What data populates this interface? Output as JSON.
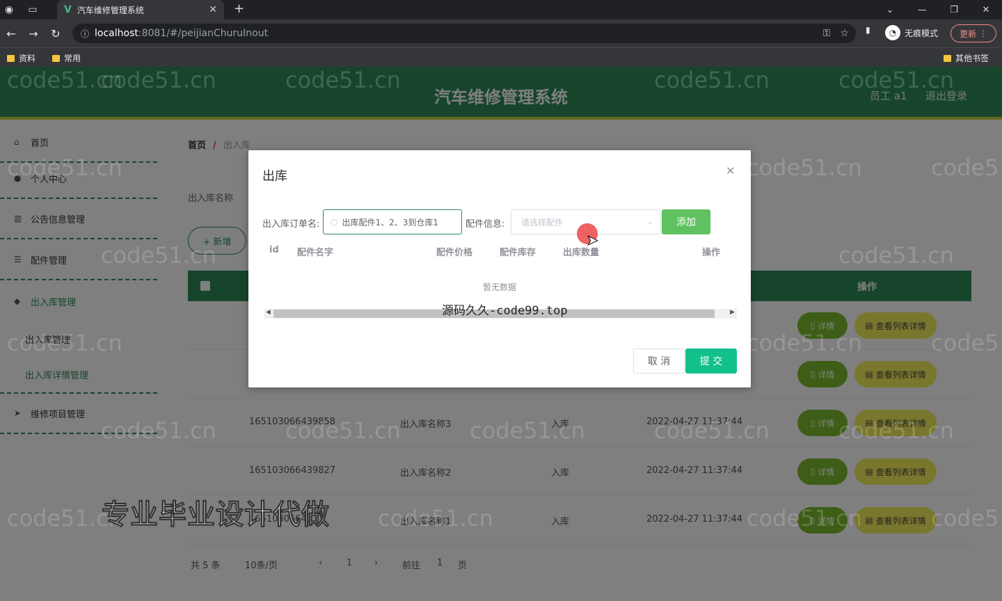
{
  "browser": {
    "tab_title": "汽车维修管理系统",
    "url_host": "localhost",
    "url_path": ":8081/#/peijianChuruInout",
    "incognito_label": "无痕模式",
    "update_label": "更新",
    "bookmarks": [
      "资料",
      "常用"
    ],
    "other_bookmarks": "其他书签"
  },
  "header": {
    "title": "汽车维修管理系统",
    "user": "员工 a1",
    "logout": "退出登录"
  },
  "sidebar": {
    "items": [
      {
        "label": "首页",
        "icon": "home-icon"
      },
      {
        "label": "个人中心",
        "icon": "user-icon"
      },
      {
        "label": "公告信息管理",
        "icon": "chart-icon"
      },
      {
        "label": "配件管理",
        "icon": "list-icon"
      },
      {
        "label": "出入库管理",
        "icon": "box-icon"
      }
    ],
    "sub_items": [
      "出入库管理",
      "出入库详情管理"
    ],
    "last_item": {
      "label": "维修项目管理",
      "icon": "send-icon"
    }
  },
  "breadcrumb": {
    "home": "首页",
    "sep": "/",
    "current": "出入库"
  },
  "filter": {
    "label": "出入库名称",
    "new_button": "+ 新增"
  },
  "table": {
    "op_header": "操作",
    "rows": [
      {
        "id": "165103066439858",
        "name": "出入库名称3",
        "type": "入库",
        "time": "2022-04-27 11:37:44"
      },
      {
        "id": "165103066439827",
        "name": "出入库名称2",
        "type": "入库",
        "time": "2022-04-27 11:37:44"
      },
      {
        "id": "1651030664...",
        "name": "出入库名称1",
        "type": "入库",
        "time": "2022-04-27 11:37:44"
      }
    ],
    "detail_btn": "详情",
    "list_btn": "查看列表详情"
  },
  "pager": {
    "total": "共 5 条",
    "size": "10条/页",
    "page": "1",
    "goto": "前往",
    "goto_val": "1",
    "page_suffix": "页"
  },
  "dialog": {
    "title": "出库",
    "order_label": "出入库订单名:",
    "order_value": "出库配件1、2、3到仓库1",
    "part_label": "配件信息:",
    "part_placeholder": "请选择配件",
    "add_button": "添加",
    "columns": [
      "id",
      "配件名字",
      "配件价格",
      "配件库存",
      "出库数量",
      "操作"
    ],
    "empty": "暂无数据",
    "cancel": "取 消",
    "submit": "提 交"
  },
  "watermark": {
    "site": "code51.cn",
    "center_text": "源码久久-code99.top",
    "promo": "专业毕业设计代做"
  },
  "colors": {
    "primary": "#2e8b57",
    "accent": "#c8d33a",
    "submit": "#13c08c"
  }
}
